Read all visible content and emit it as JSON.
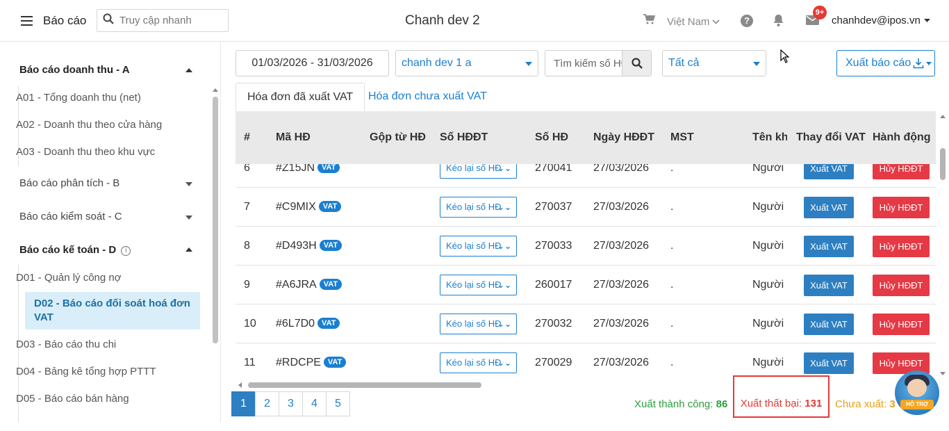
{
  "header": {
    "app_title": "Báo cáo",
    "quick_search_placeholder": "Truy cập nhanh",
    "shop_name": "Chanh dev 2",
    "language": "Việt Nam",
    "help_symbol": "?",
    "notification_badge": "9+",
    "user_email": "chanhdev@ipos.vn"
  },
  "sidebar": {
    "group_a": {
      "title": "Báo cáo doanh thu - A",
      "items": [
        "A01 - Tổng doanh thu (net)",
        "A02 - Doanh thu theo cửa hàng",
        "A03 - Doanh thu theo khu vực"
      ]
    },
    "group_b": {
      "title": "Báo cáo phân tích - B"
    },
    "group_c": {
      "title": "Báo cáo kiểm soát - C"
    },
    "group_d": {
      "title": "Báo cáo kế toán - D",
      "info_symbol": "i",
      "items": [
        "D01 - Quản lý công nợ",
        "D02 - Báo cáo đối soát hoá đơn VAT",
        "D03 - Báo cáo thu chi",
        "D04 - Bảng kê tổng hợp PTTT",
        "D05 - Báo cáo bán hàng"
      ],
      "active_index": 1
    }
  },
  "filters": {
    "date_range": "01/03/2026 - 31/03/2026",
    "store": "chanh dev 1 a",
    "search_placeholder": "Tìm kiếm số HĐ",
    "status": "Tất cả",
    "export_label": "Xuất báo cáo"
  },
  "tabs": {
    "issued": "Hóa đơn đã xuất VAT",
    "not_issued": "Hóa đơn chưa xuất VAT"
  },
  "table": {
    "headers": [
      "#",
      "Mã HĐ",
      "Gộp từ HĐ",
      "Số HĐĐT",
      "Số HĐ",
      "Ngày HĐĐT",
      "MST",
      "Tên khách hàng",
      "Thay đổi VAT",
      "Hành động"
    ],
    "vat_tag": "VAT",
    "pull_label": "Kéo lại số HĐ",
    "export_vat_label": "Xuất VAT",
    "cancel_label": "Hủy HĐĐT",
    "rows": [
      {
        "no": "6",
        "code": "#Z15JN",
        "invoice_no": "270041",
        "date": "27/03/2026",
        "tax_code": ".",
        "customer": "Người mua không lấy hóa đơn"
      },
      {
        "no": "7",
        "code": "#C9MIX",
        "invoice_no": "270037",
        "date": "27/03/2026",
        "tax_code": ".",
        "customer": "Người mua không lấy hóa đơn"
      },
      {
        "no": "8",
        "code": "#D493H",
        "invoice_no": "270033",
        "date": "27/03/2026",
        "tax_code": ".",
        "customer": "Người mua không lấy hóa đơn"
      },
      {
        "no": "9",
        "code": "#A6JRA",
        "invoice_no": "260017",
        "date": "27/03/2026",
        "tax_code": ".",
        "customer": "Người mua không lấy hóa đơn"
      },
      {
        "no": "10",
        "code": "#6L7D0",
        "invoice_no": "270032",
        "date": "27/03/2026",
        "tax_code": ".",
        "customer": "Người mua không lấy hóa đơn"
      },
      {
        "no": "11",
        "code": "#RDCPE",
        "invoice_no": "270029",
        "date": "27/03/2026",
        "tax_code": ".",
        "customer": "Người mua không lấy hóa đơn"
      }
    ]
  },
  "pagination": {
    "pages": [
      "1",
      "2",
      "3",
      "4",
      "5"
    ],
    "current": "1"
  },
  "summary": {
    "success_label": "Xuất thành công:",
    "success_count": "86",
    "fail_label": "Xuất thất bại:",
    "fail_count": "131",
    "pending_label": "Chưa xuất:",
    "pending_count": "3"
  },
  "support_label": "HỖ TRỢ",
  "colors": {
    "primary": "#1b7fd1",
    "danger": "#e53945",
    "success": "#2e9e3e",
    "warning": "#e8a11a",
    "active_menu_bg": "#d9eef8"
  }
}
